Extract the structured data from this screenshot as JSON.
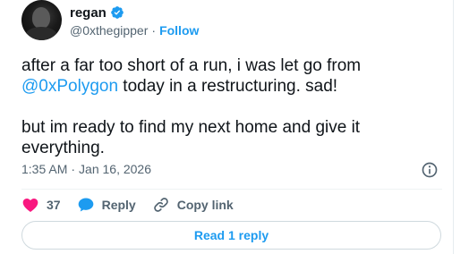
{
  "user": {
    "display_name": "regan",
    "handle": "@0xthegipper",
    "separator": "·",
    "follow_label": "Follow"
  },
  "tweet": {
    "text_part1": "after a far too short of a run, i was let go from\n",
    "mention": "@0xPolygon",
    "text_part2": " today in a restructuring. sad!\n\nbut im ready to find my next home and give it\neverything.",
    "time": "1:35 AM",
    "separator": "·",
    "date": "Jan 16, 2026"
  },
  "actions": {
    "like_count": "37",
    "reply_label": "Reply",
    "copy_link_label": "Copy link"
  },
  "read_reply_label": "Read 1 reply",
  "colors": {
    "accent": "#1d9bf0",
    "like": "#f91880",
    "text": "#0f1419",
    "muted": "#536471"
  },
  "icons": {
    "verified": "verified-badge-icon",
    "info": "info-icon",
    "like": "heart-icon",
    "reply": "speech-bubble-icon",
    "copy_link": "link-icon"
  }
}
